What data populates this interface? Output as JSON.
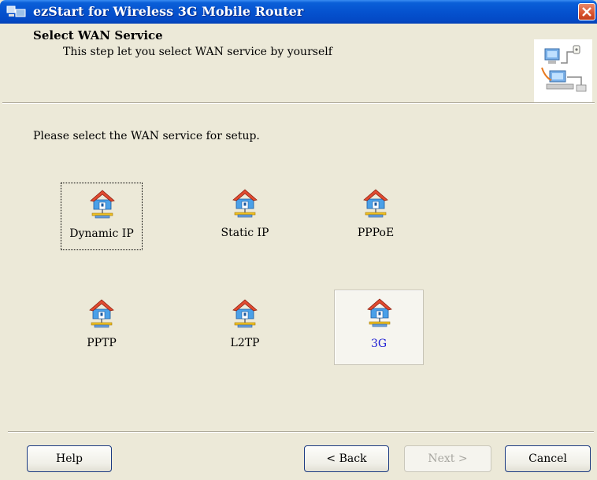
{
  "window": {
    "title": "ezStart for Wireless 3G Mobile Router"
  },
  "header": {
    "title": "Select WAN Service",
    "subtitle": "This step let you select WAN service by yourself",
    "icon": "network-computers-icon"
  },
  "body": {
    "instruction": "Please select the WAN service for setup."
  },
  "options": [
    {
      "label": "Dynamic IP",
      "state": "focused",
      "icon": "house-network-icon"
    },
    {
      "label": "Static IP",
      "state": "normal",
      "icon": "house-network-icon"
    },
    {
      "label": "PPPoE",
      "state": "normal",
      "icon": "house-network-icon"
    },
    {
      "label": "PPTP",
      "state": "normal",
      "icon": "house-network-icon"
    },
    {
      "label": "L2TP",
      "state": "normal",
      "icon": "house-network-icon"
    },
    {
      "label": "3G",
      "state": "selected",
      "icon": "house-network-icon"
    }
  ],
  "buttons": {
    "help": "Help",
    "back": "< Back",
    "next": "Next >",
    "cancel": "Cancel"
  },
  "colors": {
    "titlebar": "#0552cf",
    "selected_label": "#1a1ad4",
    "dialog_bg": "#ece9d8"
  }
}
